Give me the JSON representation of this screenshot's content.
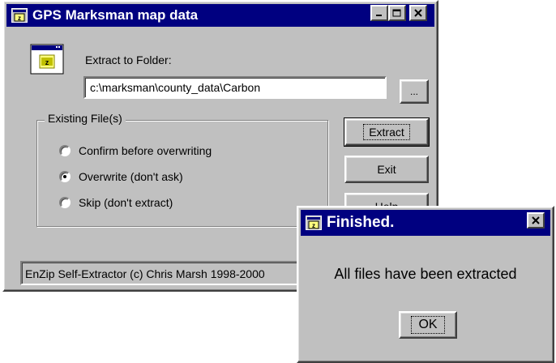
{
  "main_window": {
    "title": "GPS Marksman map data",
    "extract_label": "Extract to Folder:",
    "folder_path": "c:\\marksman\\county_data\\Carbon",
    "browse_label": "...",
    "existing_files_legend": "Existing File(s)",
    "options": [
      {
        "label": "Confirm before overwriting",
        "selected": false
      },
      {
        "label": "Overwrite (don't ask)",
        "selected": true
      },
      {
        "label": "Skip (don't extract)",
        "selected": false
      }
    ],
    "buttons": {
      "extract": "Extract",
      "exit": "Exit",
      "help": "Help"
    },
    "status": "EnZip Self-Extractor (c) Chris Marsh 1998-2000"
  },
  "finished_dialog": {
    "title": "Finished.",
    "message": "All files have been extracted",
    "ok_label": "OK"
  },
  "colors": {
    "face": "#c0c0c0",
    "titlebar": "#000080"
  },
  "icons": [
    "app-icon",
    "minimize-icon",
    "maximize-icon",
    "close-icon",
    "folder-icon"
  ]
}
